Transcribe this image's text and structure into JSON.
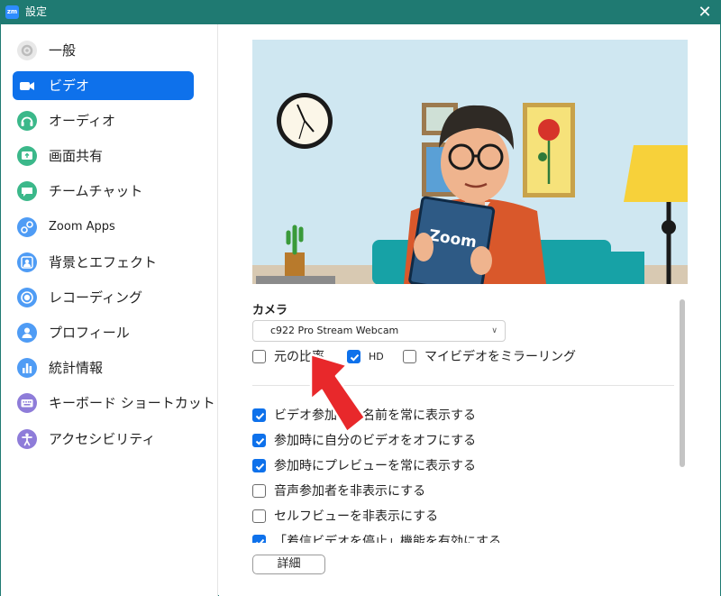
{
  "window": {
    "title": "設定",
    "logo": "zm",
    "close": "✕"
  },
  "sidebar": {
    "items": [
      {
        "label": "一般",
        "icon": "gear-icon",
        "color": "#e8e8e8"
      },
      {
        "label": "ビデオ",
        "icon": "video-camera-icon",
        "color": "#0e71eb",
        "active": true
      },
      {
        "label": "オーディオ",
        "icon": "headphones-icon",
        "color": "#3bb88a"
      },
      {
        "label": "画面共有",
        "icon": "screen-share-icon",
        "color": "#3bb88a"
      },
      {
        "label": "チームチャット",
        "icon": "chat-bubble-icon",
        "color": "#3bb88a"
      },
      {
        "label": "Zoom Apps",
        "icon": "apps-icon",
        "color": "#4f9cf5"
      },
      {
        "label": "背景とエフェクト",
        "icon": "background-person-icon",
        "color": "#4f9cf5"
      },
      {
        "label": "レコーディング",
        "icon": "record-icon",
        "color": "#4f9cf5"
      },
      {
        "label": "プロフィール",
        "icon": "profile-icon",
        "color": "#4f9cf5"
      },
      {
        "label": "統計情報",
        "icon": "bar-chart-icon",
        "color": "#4f9cf5"
      },
      {
        "label": "キーボード ショートカット",
        "icon": "keyboard-icon",
        "color": "#8e7cd9"
      },
      {
        "label": "アクセシビリティ",
        "icon": "accessibility-icon",
        "color": "#8e7cd9"
      }
    ]
  },
  "video": {
    "preview_book_text": "Zoom",
    "camera_label": "カメラ",
    "camera_value": "c922 Pro Stream Webcam",
    "options": {
      "original_ratio": {
        "label": "元の比率",
        "checked": false
      },
      "hd": {
        "label": "HD",
        "checked": true
      },
      "mirror": {
        "label": "マイビデオをミラーリング",
        "checked": false
      }
    },
    "settings": [
      {
        "label": "ビデオ参加者の名前を常に表示する",
        "checked": true
      },
      {
        "label": "参加時に自分のビデオをオフにする",
        "checked": true
      },
      {
        "label": "参加時にプレビューを常に表示する",
        "checked": true
      },
      {
        "label": "音声参加者を非表示にする",
        "checked": false
      },
      {
        "label": "セルフビューを非表示にする",
        "checked": false
      },
      {
        "label": "「着信ビデオを停止」機能を有効にする",
        "checked": true
      }
    ],
    "details_button": "詳細"
  },
  "colors": {
    "accent": "#0e71eb",
    "titlebar": "#1f7a72",
    "arrow": "#e8282b"
  }
}
